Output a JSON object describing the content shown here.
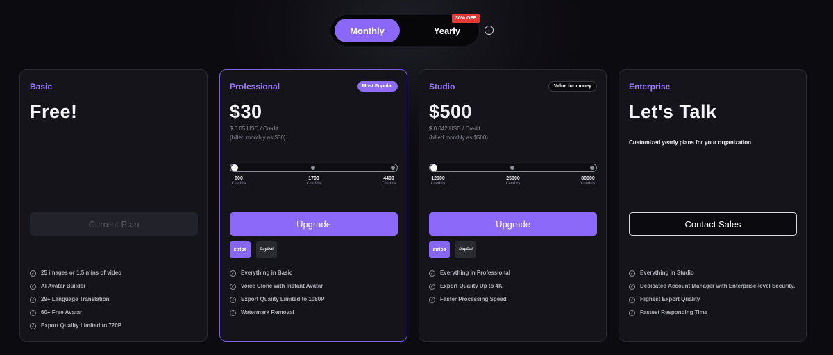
{
  "billing_toggle": {
    "monthly_label": "Monthly",
    "yearly_label": "Yearly",
    "discount_badge": "30% OFF",
    "selected": "Monthly"
  },
  "plans": [
    {
      "name": "Basic",
      "price": "Free!",
      "button_label": "Current Plan",
      "features": [
        "25 images or 1.5 mins of video",
        "AI Avatar Builder",
        "29+ Language Translation",
        "60+ Free Avatar",
        "Export Quality Limited to 720P"
      ]
    },
    {
      "name": "Professional",
      "badge": "Most Popular",
      "price": "$30",
      "per_credit": "$ 0.05 USD / Credit",
      "billing_note": "(billed monthly as $30)",
      "slider": {
        "selected_index": 0,
        "ticks": [
          {
            "value": "600",
            "unit": "Credits"
          },
          {
            "value": "1700",
            "unit": "Credits"
          },
          {
            "value": "4400",
            "unit": "Credits"
          }
        ]
      },
      "button_label": "Upgrade",
      "payments": [
        "stripe",
        "PayPal"
      ],
      "features": [
        "Everything in Basic",
        "Voice Clone with Instant Avatar",
        "Export Quality Limited to 1080P",
        "Watermark Removal"
      ]
    },
    {
      "name": "Studio",
      "badge": "Value for money",
      "price": "$500",
      "per_credit": "$ 0.042 USD / Credit",
      "billing_note": "(billed monthly as $500)",
      "slider": {
        "selected_index": 0,
        "ticks": [
          {
            "value": "12000",
            "unit": "Credits"
          },
          {
            "value": "25000",
            "unit": "Credits"
          },
          {
            "value": "80000",
            "unit": "Credits"
          }
        ]
      },
      "button_label": "Upgrade",
      "payments": [
        "stripe",
        "PayPal"
      ],
      "features": [
        "Everything in Professional",
        "Export Quality Up to 4K",
        "Faster Processing Speed"
      ]
    },
    {
      "name": "Enterprise",
      "price": "Let's Talk",
      "description": "Customized yearly plans for your organization",
      "button_label": "Contact Sales",
      "features": [
        "Everything in Studio",
        "Dedicated Account Manager with Enterprise-level Security.",
        "Highest Export Quality",
        "Fastest Responding Time"
      ]
    }
  ],
  "colors": {
    "accent": "#8b68f7",
    "background": "#0f0e14",
    "card": "#15141b",
    "badge_red": "#e53935"
  },
  "icons": {
    "info": "info-circle-icon",
    "feature_check": "check-circle-icon"
  }
}
